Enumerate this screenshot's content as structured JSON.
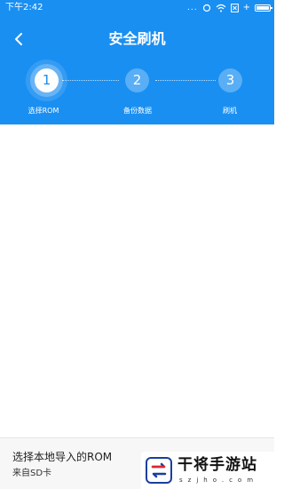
{
  "status_bar": {
    "time": "下午2:42",
    "dots": "..."
  },
  "header": {
    "title": "安全刷机",
    "back_icon": "chevron-left-icon"
  },
  "steps": [
    {
      "number": "1",
      "label": "选择ROM",
      "state": "active"
    },
    {
      "number": "2",
      "label": "备份数据",
      "state": "inactive"
    },
    {
      "number": "3",
      "label": "刷机",
      "state": "inactive"
    }
  ],
  "bottom_option": {
    "title": "选择本地导入的ROM",
    "subtitle": "来自SD卡"
  },
  "watermark": {
    "title": "干将手游站",
    "domain": "szjho.com"
  },
  "colors": {
    "primary": "#1a8ff2",
    "background": "#ffffff",
    "bottom_bar": "#f7f7f7"
  }
}
